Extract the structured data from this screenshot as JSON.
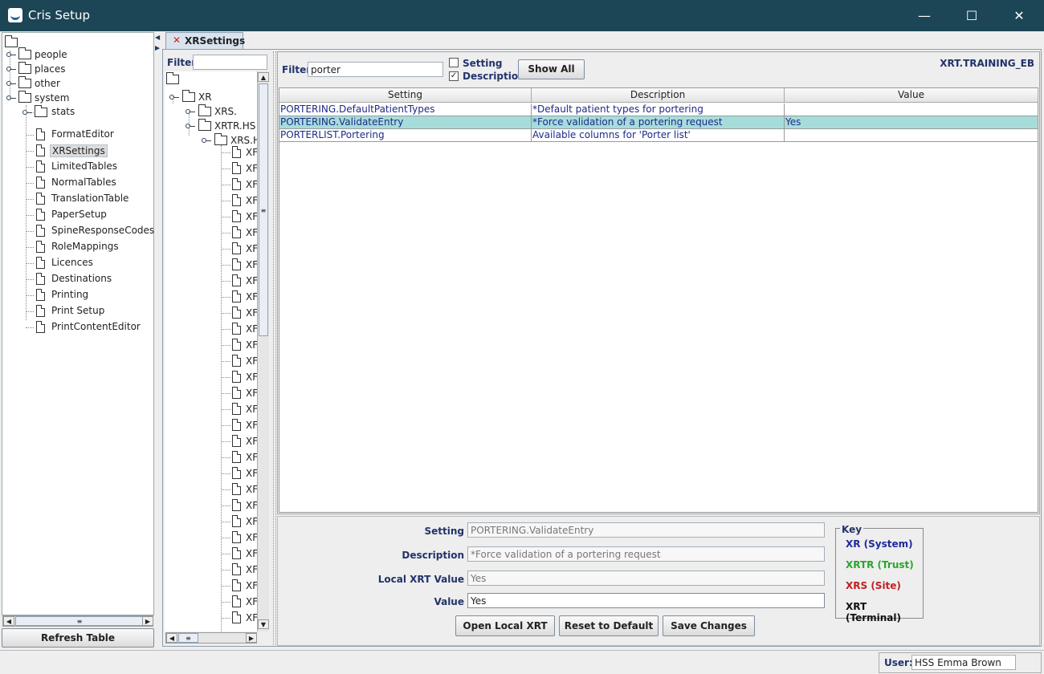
{
  "window": {
    "title": "Cris Setup",
    "minimize": "—",
    "maximize": "☐",
    "close": "✕"
  },
  "left_tree": {
    "top_level": [
      "people",
      "places",
      "other",
      "system"
    ],
    "system_children": [
      "stats",
      "FormatEditor",
      "XRSettings",
      "LimitedTables",
      "NormalTables",
      "TranslationTable",
      "PaperSetup",
      "SpineResponseCodes",
      "RoleMappings",
      "Licences",
      "Destinations",
      "Printing",
      "Print Setup",
      "PrintContentEditor"
    ],
    "selected": "XRSettings",
    "refresh_button": "Refresh Table"
  },
  "tab": {
    "label": "XRSettings",
    "close_glyph": "✕"
  },
  "middle": {
    "filter_label": "Filter",
    "filter_value": "",
    "nodes": {
      "root": "XR",
      "level1a": "XRS.",
      "level1b": "XRTR.HS",
      "level2": "XRS.H"
    },
    "leaf_label": "XF",
    "leaf_count": 30
  },
  "settings": {
    "filter_label": "Filter",
    "filter_value": "porter",
    "chk_setting_label": "Setting",
    "chk_setting_checked": false,
    "chk_description_label": "Description",
    "chk_description_checked": true,
    "show_all": "Show All",
    "context": "XRT.TRAINING_EB",
    "columns": [
      "Setting",
      "Description",
      "Value"
    ],
    "rows": [
      {
        "setting": "PORTERING.DefaultPatientTypes",
        "description": "*Default patient types for portering",
        "value": ""
      },
      {
        "setting": "PORTERING.ValidateEntry",
        "description": "*Force validation of a portering request",
        "value": "Yes"
      },
      {
        "setting": "PORTERLIST.Portering",
        "description": " Available columns for 'Porter list'",
        "value": ""
      }
    ],
    "selected_row": 1
  },
  "form": {
    "setting_label": "Setting",
    "setting_value": "PORTERING.ValidateEntry",
    "description_label": "Description",
    "description_value": "*Force validation of a portering request",
    "local_label": "Local XRT Value",
    "local_value": "Yes",
    "value_label": "Value",
    "value_value": "Yes",
    "btn_open": "Open Local XRT",
    "btn_reset": "Reset to Default",
    "btn_save": "Save Changes"
  },
  "key": {
    "title": "Key",
    "items": [
      {
        "label": "XR (System)",
        "color": "#1f2a9a"
      },
      {
        "label": "XRTR (Trust)",
        "color": "#2aa52a"
      },
      {
        "label": "XRS (Site)",
        "color": "#c02020"
      },
      {
        "label": "XRT (Terminal)",
        "color": "#111111"
      }
    ]
  },
  "status": {
    "user_label": "User:",
    "user_value": "HSS Emma Brown"
  },
  "icons": {
    "collapse": "◀",
    "scroll_up": "▲",
    "scroll_down": "▼",
    "scroll_left": "◀",
    "scroll_right": "▶",
    "grip": "≡",
    "check": "✓"
  }
}
